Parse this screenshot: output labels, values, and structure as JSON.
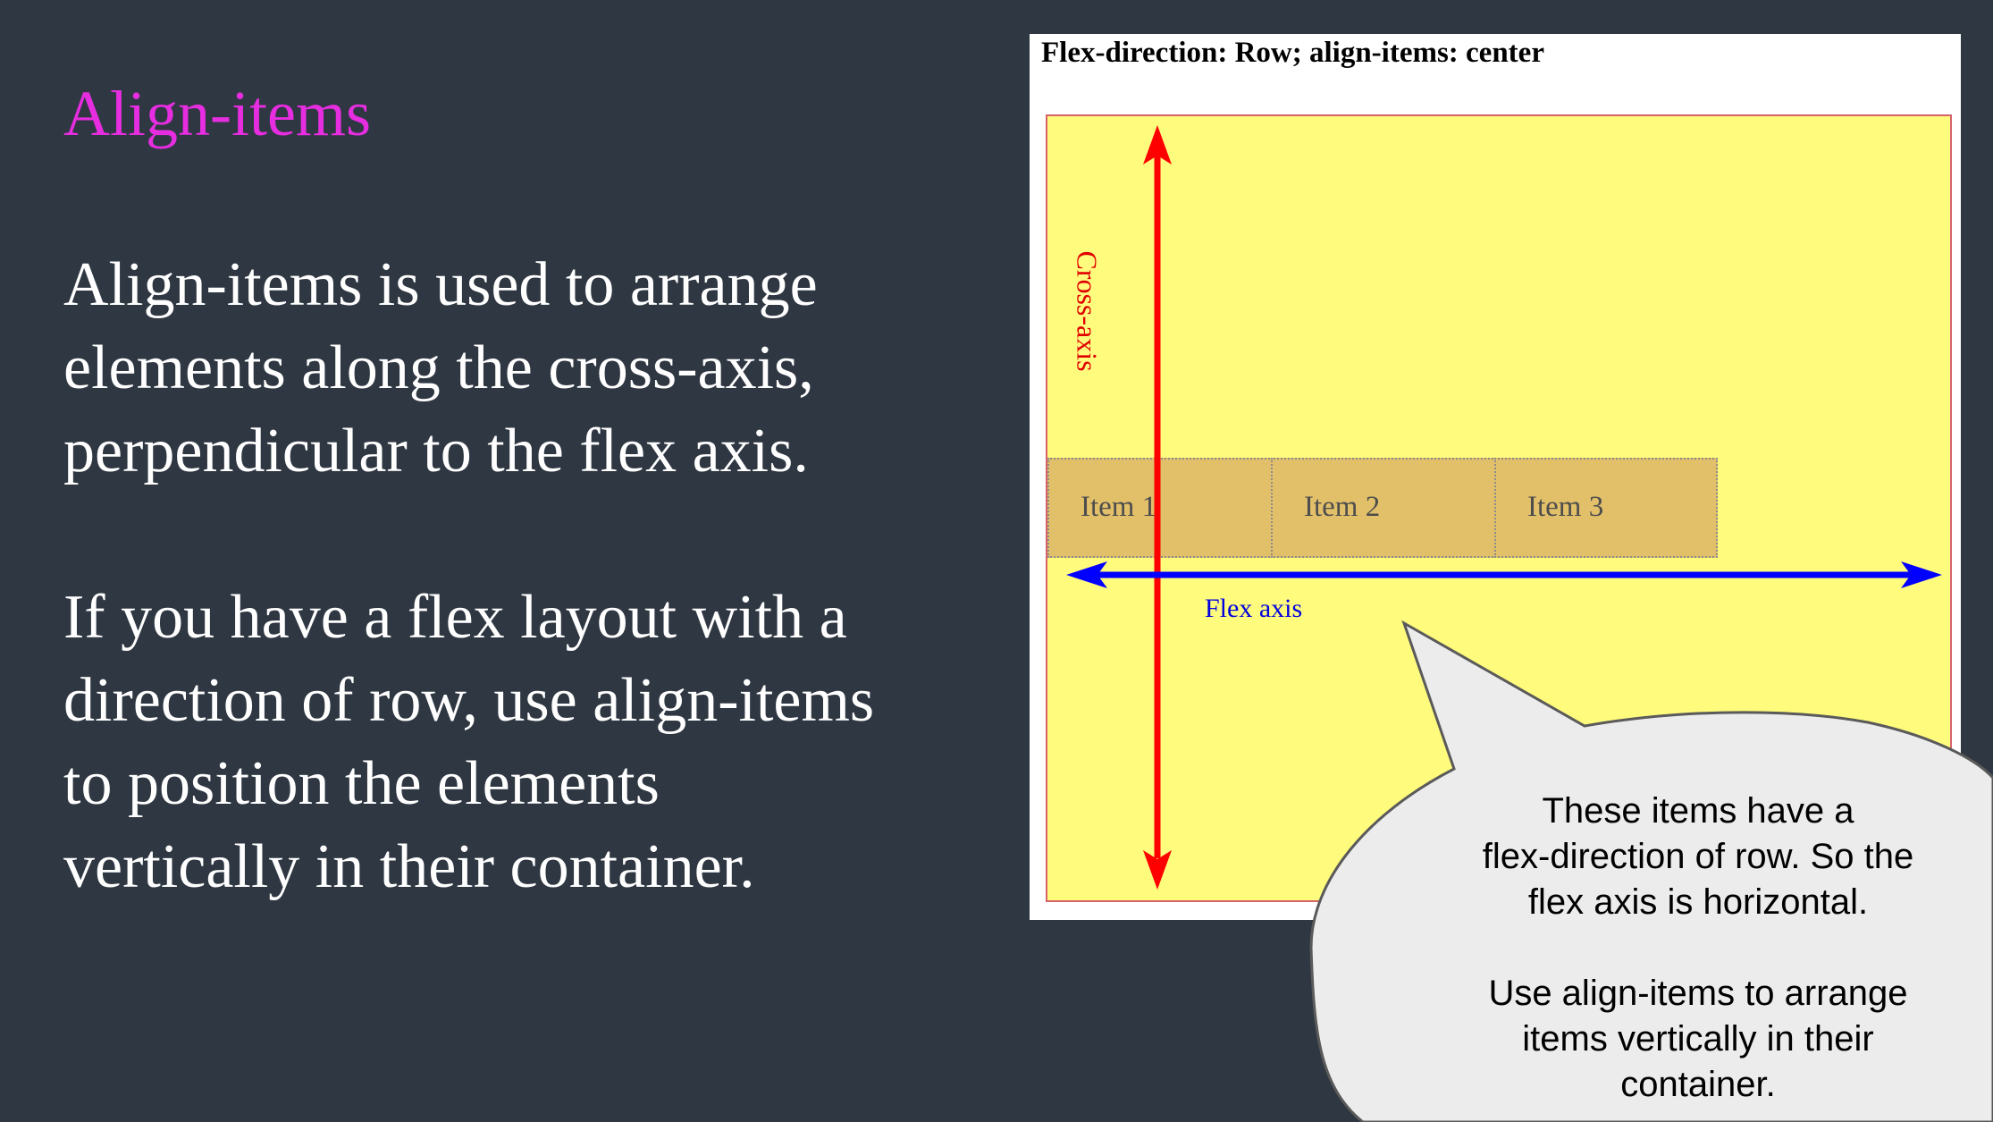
{
  "slide": {
    "title": "Align-items",
    "paragraph1": [
      "Align-items is used to arrange",
      "elements along the cross-axis,",
      "perpendicular to the flex axis."
    ],
    "paragraph2": [
      "If you have a flex layout with a",
      "direction of row, use align-items",
      "to position the elements",
      "vertically in their container."
    ]
  },
  "demo": {
    "heading": "Flex-direction: Row; align-items: center",
    "items": [
      "Item 1",
      "Item 2",
      "Item 3"
    ],
    "cross_axis_label": "Cross-axis",
    "flex_axis_label": "Flex axis"
  },
  "callout": {
    "lines1": [
      "These items have a",
      "flex-direction of row. So the",
      "flex axis is horizontal."
    ],
    "lines2": [
      "Use align-items to arrange",
      "items vertically in their",
      "container."
    ]
  },
  "colors": {
    "background": "#2f3742",
    "title": "#e62de0",
    "container": "#fffb7d",
    "item": "#e2c06a",
    "cross_axis": "#ff0000",
    "flex_axis": "#0000ff",
    "callout_fill": "#ececec"
  }
}
